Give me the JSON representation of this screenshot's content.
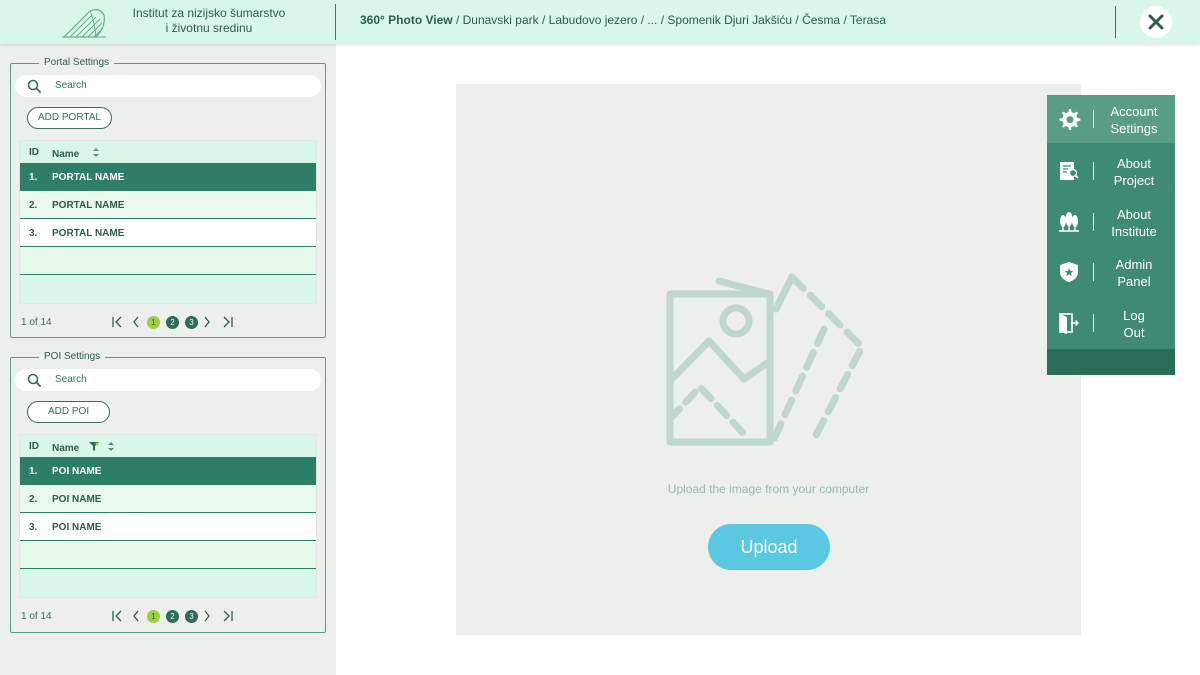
{
  "header": {
    "institute_line1": "Institut za nizijsko šumarstvo",
    "institute_line2": "i životnu sredinu",
    "breadcrumb_bold": "360° Photo View",
    "breadcrumb_rest": " / Dunavski park / Labudovo jezero / ...  / Spomenik Djuri Jakšiću / Česma / Terasa"
  },
  "portal": {
    "legend": "Portal Settings",
    "search_placeholder": "Search",
    "add_label": "ADD PORTAL",
    "col_id": "ID",
    "col_name": "Name",
    "rows": [
      {
        "id": "1.",
        "name": "PORTAL NAME"
      },
      {
        "id": "2.",
        "name": "PORTAL NAME"
      },
      {
        "id": "3.",
        "name": "PORTAL NAME"
      }
    ],
    "count": "1 of 14",
    "pages": [
      "1",
      "2",
      "3"
    ]
  },
  "poi": {
    "legend": "POI Settings",
    "search_placeholder": "Search",
    "add_label": "ADD POI",
    "col_id": "ID",
    "col_name": "Name",
    "rows": [
      {
        "id": "1.",
        "name": "POI NAME"
      },
      {
        "id": "2.",
        "name": "POI NAME"
      },
      {
        "id": "3.",
        "name": "POI NAME"
      }
    ],
    "count": "1 of 14",
    "pages": [
      "1",
      "2",
      "3"
    ]
  },
  "main": {
    "upload_hint": "Upload the image from your computer",
    "upload_label": "Upload"
  },
  "menu": {
    "items": [
      {
        "line1": "Account",
        "line2": "Settings",
        "icon": "gear-icon"
      },
      {
        "line1": "About",
        "line2": "Project",
        "icon": "document-icon"
      },
      {
        "line1": "About",
        "line2": "Institute",
        "icon": "trees-icon"
      },
      {
        "line1": "Admin",
        "line2": "Panel",
        "icon": "shield-star-icon"
      },
      {
        "line1": "Log",
        "line2": "Out",
        "icon": "logout-door-icon"
      }
    ]
  },
  "colors": {
    "header_bg": "#d8f7e9",
    "primary": "#2e7d67",
    "menu_bg": "#3f8a72",
    "accent_upload": "#5bc8e1",
    "page_active": "#9ad13f"
  }
}
